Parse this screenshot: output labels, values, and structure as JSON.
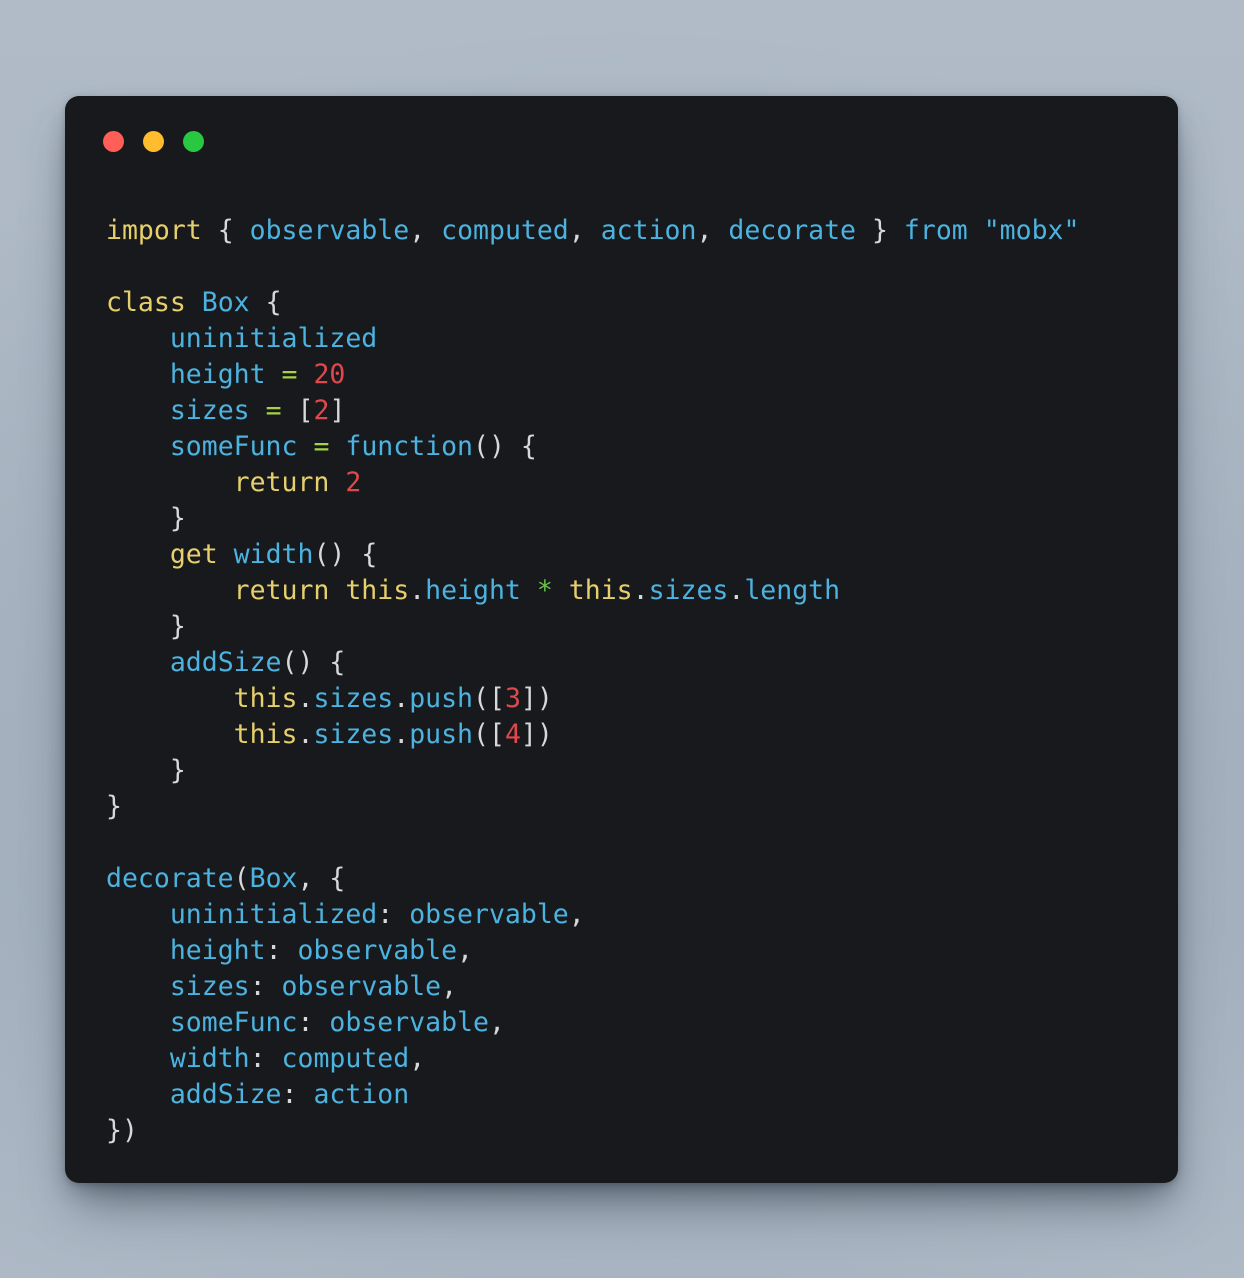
{
  "window": {
    "title": "",
    "background_color": "#17191c",
    "page_background_color": "#aeb9c6",
    "corner_radius_px": 14,
    "controls": [
      {
        "name": "close",
        "color": "#ff5f57",
        "label": "Close"
      },
      {
        "name": "minimize",
        "color": "#febc2e",
        "label": "Minimize"
      },
      {
        "name": "maximize",
        "color": "#28c840",
        "label": "Maximize"
      }
    ]
  },
  "theme": {
    "keyword": "#e6d06c",
    "identifier": "#4cb3e0",
    "punctuation": "#d6d8d9",
    "number": "#e0484c",
    "operator_assign": "#a6d14a",
    "operator_mul": "#69c14a",
    "string": "#4cb3e0",
    "this": "#e6d06c"
  },
  "code": {
    "language": "javascript",
    "plain_text": "import { observable, computed, action, decorate } from \"mobx\"\n\nclass Box {\n    uninitialized\n    height = 20\n    sizes = [2]\n    someFunc = function() {\n        return 2\n    }\n    get width() {\n        return this.height * this.sizes.length\n    }\n    addSize() {\n        this.sizes.push([3])\n        this.sizes.push([4])\n    }\n}\n\ndecorate(Box, {\n    uninitialized: observable,\n    height: observable,\n    sizes: observable,\n    someFunc: observable,\n    width: computed,\n    addSize: action\n})",
    "lines": [
      [
        {
          "t": "keyword",
          "v": "import"
        },
        {
          "t": "plain",
          "v": " "
        },
        {
          "t": "punct",
          "v": "{"
        },
        {
          "t": "plain",
          "v": " "
        },
        {
          "t": "ident",
          "v": "observable"
        },
        {
          "t": "punct",
          "v": ","
        },
        {
          "t": "plain",
          "v": " "
        },
        {
          "t": "ident",
          "v": "computed"
        },
        {
          "t": "punct",
          "v": ","
        },
        {
          "t": "plain",
          "v": " "
        },
        {
          "t": "ident",
          "v": "action"
        },
        {
          "t": "punct",
          "v": ","
        },
        {
          "t": "plain",
          "v": " "
        },
        {
          "t": "ident",
          "v": "decorate"
        },
        {
          "t": "plain",
          "v": " "
        },
        {
          "t": "punct",
          "v": "}"
        },
        {
          "t": "plain",
          "v": " "
        },
        {
          "t": "string",
          "v": "from"
        },
        {
          "t": "plain",
          "v": " "
        },
        {
          "t": "string",
          "v": "\"mobx\""
        }
      ],
      [],
      [
        {
          "t": "keyword",
          "v": "class"
        },
        {
          "t": "plain",
          "v": " "
        },
        {
          "t": "ident",
          "v": "Box"
        },
        {
          "t": "plain",
          "v": " "
        },
        {
          "t": "punct",
          "v": "{"
        }
      ],
      [
        {
          "t": "plain",
          "v": "    "
        },
        {
          "t": "ident",
          "v": "uninitialized"
        }
      ],
      [
        {
          "t": "plain",
          "v": "    "
        },
        {
          "t": "ident",
          "v": "height"
        },
        {
          "t": "plain",
          "v": " "
        },
        {
          "t": "operator",
          "v": "="
        },
        {
          "t": "plain",
          "v": " "
        },
        {
          "t": "number",
          "v": "20"
        }
      ],
      [
        {
          "t": "plain",
          "v": "    "
        },
        {
          "t": "ident",
          "v": "sizes"
        },
        {
          "t": "plain",
          "v": " "
        },
        {
          "t": "operator",
          "v": "="
        },
        {
          "t": "plain",
          "v": " "
        },
        {
          "t": "punct",
          "v": "["
        },
        {
          "t": "number",
          "v": "2"
        },
        {
          "t": "punct",
          "v": "]"
        }
      ],
      [
        {
          "t": "plain",
          "v": "    "
        },
        {
          "t": "ident",
          "v": "someFunc"
        },
        {
          "t": "plain",
          "v": " "
        },
        {
          "t": "operator",
          "v": "="
        },
        {
          "t": "plain",
          "v": " "
        },
        {
          "t": "ident",
          "v": "function"
        },
        {
          "t": "punct",
          "v": "()"
        },
        {
          "t": "plain",
          "v": " "
        },
        {
          "t": "punct",
          "v": "{"
        }
      ],
      [
        {
          "t": "plain",
          "v": "        "
        },
        {
          "t": "keyword",
          "v": "return"
        },
        {
          "t": "plain",
          "v": " "
        },
        {
          "t": "number",
          "v": "2"
        }
      ],
      [
        {
          "t": "plain",
          "v": "    "
        },
        {
          "t": "punct",
          "v": "}"
        }
      ],
      [
        {
          "t": "plain",
          "v": "    "
        },
        {
          "t": "keyword",
          "v": "get"
        },
        {
          "t": "plain",
          "v": " "
        },
        {
          "t": "ident",
          "v": "width"
        },
        {
          "t": "punct",
          "v": "()"
        },
        {
          "t": "plain",
          "v": " "
        },
        {
          "t": "punct",
          "v": "{"
        }
      ],
      [
        {
          "t": "plain",
          "v": "        "
        },
        {
          "t": "keyword",
          "v": "return"
        },
        {
          "t": "plain",
          "v": " "
        },
        {
          "t": "this",
          "v": "this"
        },
        {
          "t": "punct",
          "v": "."
        },
        {
          "t": "ident",
          "v": "height"
        },
        {
          "t": "plain",
          "v": " "
        },
        {
          "t": "mulop",
          "v": "*"
        },
        {
          "t": "plain",
          "v": " "
        },
        {
          "t": "this",
          "v": "this"
        },
        {
          "t": "punct",
          "v": "."
        },
        {
          "t": "ident",
          "v": "sizes"
        },
        {
          "t": "punct",
          "v": "."
        },
        {
          "t": "ident",
          "v": "length"
        }
      ],
      [
        {
          "t": "plain",
          "v": "    "
        },
        {
          "t": "punct",
          "v": "}"
        }
      ],
      [
        {
          "t": "plain",
          "v": "    "
        },
        {
          "t": "ident",
          "v": "addSize"
        },
        {
          "t": "punct",
          "v": "()"
        },
        {
          "t": "plain",
          "v": " "
        },
        {
          "t": "punct",
          "v": "{"
        }
      ],
      [
        {
          "t": "plain",
          "v": "        "
        },
        {
          "t": "this",
          "v": "this"
        },
        {
          "t": "punct",
          "v": "."
        },
        {
          "t": "ident",
          "v": "sizes"
        },
        {
          "t": "punct",
          "v": "."
        },
        {
          "t": "ident",
          "v": "push"
        },
        {
          "t": "punct",
          "v": "(["
        },
        {
          "t": "number",
          "v": "3"
        },
        {
          "t": "punct",
          "v": "])"
        }
      ],
      [
        {
          "t": "plain",
          "v": "        "
        },
        {
          "t": "this",
          "v": "this"
        },
        {
          "t": "punct",
          "v": "."
        },
        {
          "t": "ident",
          "v": "sizes"
        },
        {
          "t": "punct",
          "v": "."
        },
        {
          "t": "ident",
          "v": "push"
        },
        {
          "t": "punct",
          "v": "(["
        },
        {
          "t": "number",
          "v": "4"
        },
        {
          "t": "punct",
          "v": "])"
        }
      ],
      [
        {
          "t": "plain",
          "v": "    "
        },
        {
          "t": "punct",
          "v": "}"
        }
      ],
      [
        {
          "t": "punct",
          "v": "}"
        }
      ],
      [],
      [
        {
          "t": "ident",
          "v": "decorate"
        },
        {
          "t": "punct",
          "v": "("
        },
        {
          "t": "ident",
          "v": "Box"
        },
        {
          "t": "punct",
          "v": ","
        },
        {
          "t": "plain",
          "v": " "
        },
        {
          "t": "punct",
          "v": "{"
        }
      ],
      [
        {
          "t": "plain",
          "v": "    "
        },
        {
          "t": "ident",
          "v": "uninitialized"
        },
        {
          "t": "punct",
          "v": ":"
        },
        {
          "t": "plain",
          "v": " "
        },
        {
          "t": "ident",
          "v": "observable"
        },
        {
          "t": "punct",
          "v": ","
        }
      ],
      [
        {
          "t": "plain",
          "v": "    "
        },
        {
          "t": "ident",
          "v": "height"
        },
        {
          "t": "punct",
          "v": ":"
        },
        {
          "t": "plain",
          "v": " "
        },
        {
          "t": "ident",
          "v": "observable"
        },
        {
          "t": "punct",
          "v": ","
        }
      ],
      [
        {
          "t": "plain",
          "v": "    "
        },
        {
          "t": "ident",
          "v": "sizes"
        },
        {
          "t": "punct",
          "v": ":"
        },
        {
          "t": "plain",
          "v": " "
        },
        {
          "t": "ident",
          "v": "observable"
        },
        {
          "t": "punct",
          "v": ","
        }
      ],
      [
        {
          "t": "plain",
          "v": "    "
        },
        {
          "t": "ident",
          "v": "someFunc"
        },
        {
          "t": "punct",
          "v": ":"
        },
        {
          "t": "plain",
          "v": " "
        },
        {
          "t": "ident",
          "v": "observable"
        },
        {
          "t": "punct",
          "v": ","
        }
      ],
      [
        {
          "t": "plain",
          "v": "    "
        },
        {
          "t": "ident",
          "v": "width"
        },
        {
          "t": "punct",
          "v": ":"
        },
        {
          "t": "plain",
          "v": " "
        },
        {
          "t": "ident",
          "v": "computed"
        },
        {
          "t": "punct",
          "v": ","
        }
      ],
      [
        {
          "t": "plain",
          "v": "    "
        },
        {
          "t": "ident",
          "v": "addSize"
        },
        {
          "t": "punct",
          "v": ":"
        },
        {
          "t": "plain",
          "v": " "
        },
        {
          "t": "ident",
          "v": "action"
        }
      ],
      [
        {
          "t": "punct",
          "v": "})"
        }
      ]
    ]
  }
}
